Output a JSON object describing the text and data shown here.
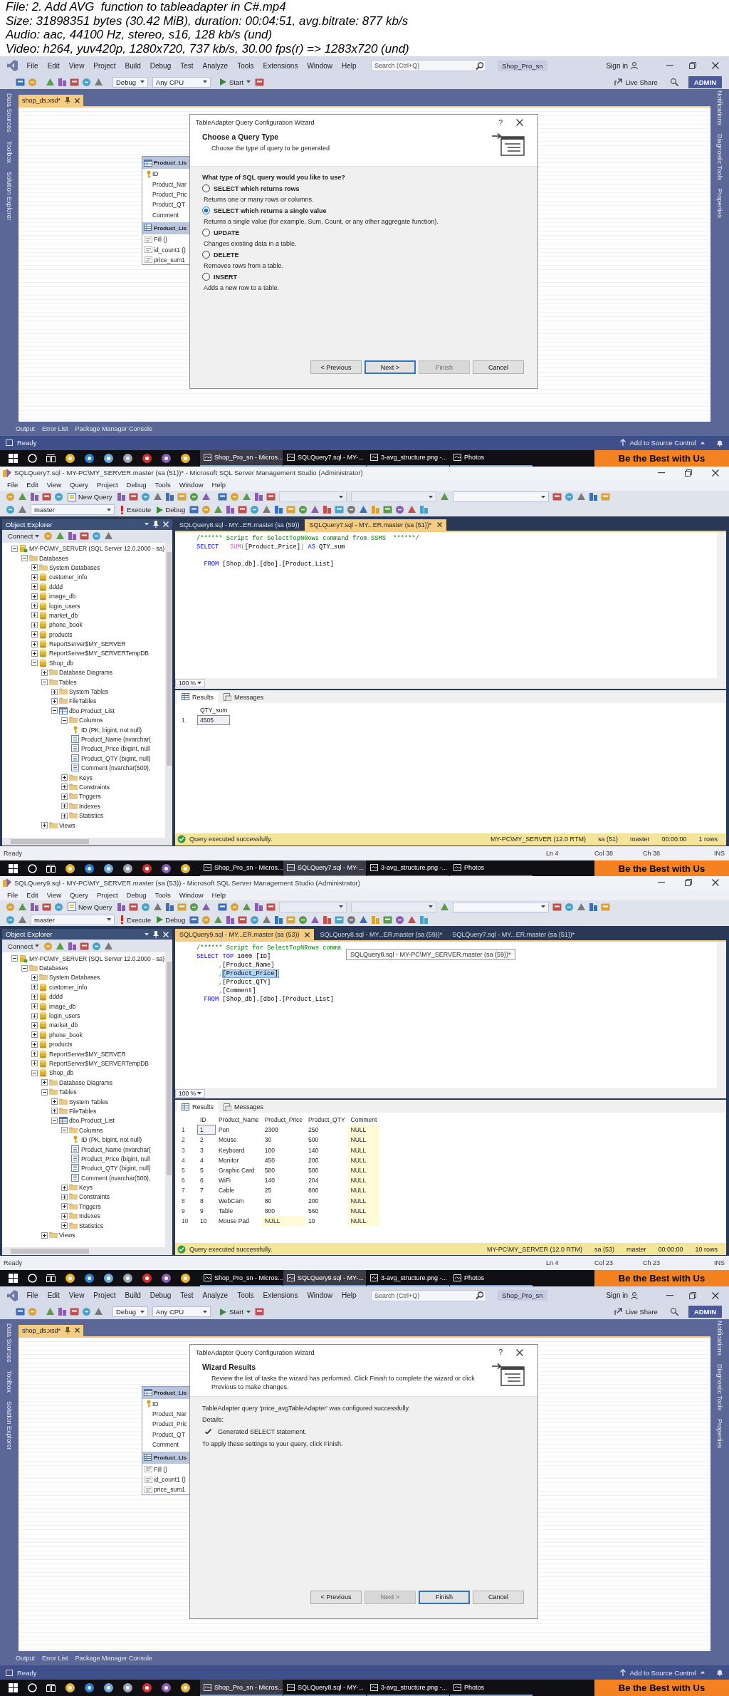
{
  "header": {
    "lines": [
      "File: 2. Add AVG  function to tableadapter in C#.mp4",
      "Size: 31898351 bytes (30.42 MiB), duration: 00:04:51, avg.bitrate: 877 kb/s",
      "Audio: aac, 44100 Hz, stereo, s16, 128 kb/s (und)",
      "Video: h264, yuv420p, 1280x720, 737 kb/s, 30.00 fps(r) => 1283x720 (und)"
    ]
  },
  "frames": [
    {
      "kind": "vs",
      "menu": [
        "File",
        "Edit",
        "View",
        "Project",
        "Build",
        "Debug",
        "Test",
        "Analyze",
        "Tools",
        "Extensions",
        "Window",
        "Help"
      ],
      "search": {
        "placeholder": "Search (Ctrl+Q)"
      },
      "solution_name": "Shop_Pro_sn",
      "sign_in": "Sign in",
      "toolbar": {
        "configuration": "Debug",
        "platform": "Any CPU",
        "start": "Start"
      },
      "live_share": "Live Share",
      "account": "ADMIN",
      "left_rail": [
        "Data Sources",
        "Toolbox",
        "Solution Explorer"
      ],
      "right_rail": [
        "Notifications",
        "Diagnostic Tools",
        "Properties"
      ],
      "document_tab": "shop_ds.xsd*",
      "designer": {
        "table": {
          "title": "Product_Lis",
          "columns": [
            {
              "name": "ID",
              "primary_key": true
            },
            {
              "name": "Product_Nar",
              "primary_key": false
            },
            {
              "name": "Product_Pric",
              "primary_key": false
            },
            {
              "name": "Product_QT",
              "primary_key": false
            },
            {
              "name": "Comment",
              "primary_key": false
            }
          ]
        },
        "adapter": {
          "title": "Product_Lis",
          "methods": [
            "Fill ()",
            "id_count1 ()",
            "price_sum1"
          ]
        }
      },
      "dialog": {
        "kind": "query_type",
        "title": "TableAdapter Query Configuration Wizard",
        "help": "?",
        "heading": "Choose a Query Type",
        "subheading": "Choose the type of query to be generated",
        "question": "What type of SQL query would you like to use?",
        "options": [
          {
            "label": "SELECT which returns rows",
            "description": "Returns one or many rows or columns.",
            "selected": false
          },
          {
            "label": "SELECT which returns a single value",
            "description": "Returns a single value (for example, Sum, Count, or any other aggregate function).",
            "selected": true
          },
          {
            "label": "UPDATE",
            "description": "Changes existing data in a table.",
            "selected": false
          },
          {
            "label": "DELETE",
            "description": "Removes rows from a table.",
            "selected": false
          },
          {
            "label": "INSERT",
            "description": "Adds a new row to a table.",
            "selected": false
          }
        ],
        "buttons": [
          {
            "label": "< Previous",
            "disabled": false,
            "default": false
          },
          {
            "label": "Next >",
            "disabled": false,
            "default": true
          },
          {
            "label": "Finish",
            "disabled": true,
            "default": false
          },
          {
            "label": "Cancel",
            "disabled": false,
            "default": false
          }
        ]
      },
      "bottom_tabs": [
        "Output",
        "Error List",
        "Package Manager Console"
      ],
      "status": {
        "text": "Ready",
        "source_control": "Add to Source Control"
      },
      "taskbar": {
        "items": [
          {
            "label": "Shop_Pro_sn - Micros...",
            "selected": true
          },
          {
            "label": "SQLQuery7.sql - MY-...",
            "selected": false
          },
          {
            "label": "3-avg_structure.png -...",
            "selected": false
          },
          {
            "label": "Photos",
            "selected": false
          }
        ],
        "banner": "Be the Best with Us"
      }
    },
    {
      "kind": "ssms",
      "title": "SQLQuery7.sql - MY-PC\\MY_SERVER.master (sa (51))* - Microsoft SQL Server Management Studio (Administrator)",
      "menu": [
        "File",
        "Edit",
        "View",
        "Query",
        "Project",
        "Debug",
        "Tools",
        "Window",
        "Help"
      ],
      "toolbar": {
        "new_query": "New Query",
        "database": "master",
        "execute": "Execute",
        "debug": "Debug"
      },
      "object_explorer": {
        "title": "Object Explorer",
        "connect": "Connect",
        "tree": [
          {
            "label": "MY-PC\\MY_SERVER (SQL Server 12.0.2000 - sa)",
            "kind": "server",
            "expanded": true,
            "children": [
              {
                "label": "Databases",
                "kind": "folder",
                "expanded": true,
                "children": [
                  {
                    "label": "System Databases",
                    "kind": "folder",
                    "expanded": false
                  },
                  {
                    "label": "customer_info",
                    "kind": "database",
                    "expanded": false
                  },
                  {
                    "label": "dddd",
                    "kind": "database",
                    "expanded": false
                  },
                  {
                    "label": "image_db",
                    "kind": "database",
                    "expanded": false
                  },
                  {
                    "label": "login_users",
                    "kind": "database",
                    "expanded": false
                  },
                  {
                    "label": "market_db",
                    "kind": "database",
                    "expanded": false
                  },
                  {
                    "label": "phone_book",
                    "kind": "database",
                    "expanded": false
                  },
                  {
                    "label": "products",
                    "kind": "database",
                    "expanded": false
                  },
                  {
                    "label": "ReportServer$MY_SERVER",
                    "kind": "database",
                    "expanded": false
                  },
                  {
                    "label": "ReportServer$MY_SERVERTempDB",
                    "kind": "database",
                    "expanded": false
                  },
                  {
                    "label": "Shop_db",
                    "kind": "database",
                    "expanded": true,
                    "children": [
                      {
                        "label": "Database Diagrams",
                        "kind": "folder",
                        "expanded": false
                      },
                      {
                        "label": "Tables",
                        "kind": "folder",
                        "expanded": true,
                        "children": [
                          {
                            "label": "System Tables",
                            "kind": "folder",
                            "expanded": false
                          },
                          {
                            "label": "FileTables",
                            "kind": "folder",
                            "expanded": false
                          },
                          {
                            "label": "dbo.Product_List",
                            "kind": "table",
                            "expanded": true,
                            "children": [
                              {
                                "label": "Columns",
                                "kind": "folder",
                                "expanded": true,
                                "children": [
                                  {
                                    "label": "ID (PK, bigint, not null)",
                                    "kind": "key"
                                  },
                                  {
                                    "label": "Product_Name (nvarchar(",
                                    "kind": "column"
                                  },
                                  {
                                    "label": "Product_Price (bigint, null",
                                    "kind": "column"
                                  },
                                  {
                                    "label": "Product_QTY (bigint, null)",
                                    "kind": "column"
                                  },
                                  {
                                    "label": "Comment (nvarchar(500),",
                                    "kind": "column"
                                  }
                                ]
                              },
                              {
                                "label": "Keys",
                                "kind": "folder",
                                "expanded": false
                              },
                              {
                                "label": "Constraints",
                                "kind": "folder",
                                "expanded": false
                              },
                              {
                                "label": "Triggers",
                                "kind": "folder",
                                "expanded": false
                              },
                              {
                                "label": "Indexes",
                                "kind": "folder",
                                "expanded": false
                              },
                              {
                                "label": "Statistics",
                                "kind": "folder",
                                "expanded": false
                              }
                            ]
                          }
                        ]
                      },
                      {
                        "label": "Views",
                        "kind": "folder",
                        "expanded": false
                      }
                    ]
                  }
                ]
              }
            ]
          }
        ]
      },
      "tabs": [
        {
          "label": "SQLQuery8.sql - MY...ER.master (sa (59))",
          "selected": false
        },
        {
          "label": "SQLQuery7.sql - MY...ER.master (sa (51))*",
          "selected": true
        }
      ],
      "code": [
        {
          "blank_before": false,
          "segments": [
            {
              "text": "/****** Script for SelectTopNRows command from SSMS  ******/",
              "kind": "comment",
              "selected": false
            }
          ]
        },
        {
          "blank_before": false,
          "segments": [
            {
              "text": "SELECT",
              "kind": "keyword",
              "selected": false
            },
            {
              "text": "   SUM",
              "kind": "function",
              "selected": false
            },
            {
              "text": "(",
              "kind": "punctuation",
              "selected": false
            },
            {
              "text": "[Product_Price]",
              "kind": "plain",
              "selected": false
            },
            {
              "text": ") ",
              "kind": "punctuation",
              "selected": false
            },
            {
              "text": "AS",
              "kind": "keyword",
              "selected": false
            },
            {
              "text": " QTY_sum",
              "kind": "plain",
              "selected": false
            }
          ]
        },
        {
          "blank_before": true,
          "segments": [
            {
              "text": "  FROM",
              "kind": "keyword",
              "selected": false
            },
            {
              "text": " [Shop_db].[dbo].[Product_List]",
              "kind": "plain",
              "selected": false
            }
          ]
        }
      ],
      "zoom": "100 %",
      "result_tabs": [
        {
          "label": "Results",
          "selected": true
        },
        {
          "label": "Messages",
          "selected": false
        }
      ],
      "grid": {
        "columns": [
          "QTY_sum"
        ],
        "rows": [
          {
            "number": "1",
            "cells": [
              {
                "text": "4505",
                "null": false,
                "selected": true
              }
            ]
          }
        ]
      },
      "query_status": {
        "message": "Query executed successfully.",
        "server": "MY-PC\\MY_SERVER (12.0 RTM)",
        "login": "sa (51)",
        "database": "master",
        "elapsed": "00:00:00",
        "rows": "1 rows"
      },
      "status": {
        "text": "Ready",
        "line": "Ln 4",
        "column": "Col 38",
        "character": "Ch 38",
        "mode": "INS"
      },
      "taskbar": {
        "items": [
          {
            "label": "Shop_Pro_sn - Micros...",
            "selected": false
          },
          {
            "label": "SQLQuery7.sql - MY-...",
            "selected": true
          },
          {
            "label": "3-avg_structure.png -...",
            "selected": false
          },
          {
            "label": "Photos",
            "selected": false
          }
        ],
        "banner": "Be the Best with Us"
      }
    },
    {
      "kind": "ssms",
      "title": "SQLQuery9.sql - MY-PC\\MY_SERVER.master (sa (53)) - Microsoft SQL Server Management Studio (Administrator)",
      "menu": [
        "File",
        "Edit",
        "View",
        "Query",
        "Project",
        "Debug",
        "Tools",
        "Window",
        "Help"
      ],
      "toolbar": {
        "new_query": "New Query",
        "database": "master",
        "execute": "Execute",
        "debug": "Debug"
      },
      "object_explorer": {
        "title": "Object Explorer",
        "connect": "Connect",
        "tree": [
          {
            "label": "MY-PC\\MY_SERVER (SQL Server 12.0.2000 - sa)",
            "kind": "server",
            "expanded": true,
            "children": [
              {
                "label": "Databases",
                "kind": "folder",
                "expanded": true,
                "children": [
                  {
                    "label": "System Databases",
                    "kind": "folder",
                    "expanded": false
                  },
                  {
                    "label": "customer_info",
                    "kind": "database",
                    "expanded": false
                  },
                  {
                    "label": "dddd",
                    "kind": "database",
                    "expanded": false
                  },
                  {
                    "label": "image_db",
                    "kind": "database",
                    "expanded": false
                  },
                  {
                    "label": "login_users",
                    "kind": "database",
                    "expanded": false
                  },
                  {
                    "label": "market_db",
                    "kind": "database",
                    "expanded": false
                  },
                  {
                    "label": "phone_book",
                    "kind": "database",
                    "expanded": false
                  },
                  {
                    "label": "products",
                    "kind": "database",
                    "expanded": false
                  },
                  {
                    "label": "ReportServer$MY_SERVER",
                    "kind": "database",
                    "expanded": false
                  },
                  {
                    "label": "ReportServer$MY_SERVERTempDB",
                    "kind": "database",
                    "expanded": false
                  },
                  {
                    "label": "Shop_db",
                    "kind": "database",
                    "expanded": true,
                    "children": [
                      {
                        "label": "Database Diagrams",
                        "kind": "folder",
                        "expanded": false
                      },
                      {
                        "label": "Tables",
                        "kind": "folder",
                        "expanded": true,
                        "children": [
                          {
                            "label": "System Tables",
                            "kind": "folder",
                            "expanded": false
                          },
                          {
                            "label": "FileTables",
                            "kind": "folder",
                            "expanded": false
                          },
                          {
                            "label": "dbo.Product_List",
                            "kind": "table",
                            "expanded": true,
                            "children": [
                              {
                                "label": "Columns",
                                "kind": "folder",
                                "expanded": true,
                                "children": [
                                  {
                                    "label": "ID (PK, bigint, not null)",
                                    "kind": "key"
                                  },
                                  {
                                    "label": "Product_Name (nvarchar(",
                                    "kind": "column"
                                  },
                                  {
                                    "label": "Product_Price (bigint, null",
                                    "kind": "column"
                                  },
                                  {
                                    "label": "Product_QTY (bigint, null)",
                                    "kind": "column"
                                  },
                                  {
                                    "label": "Comment (nvarchar(500),",
                                    "kind": "column"
                                  }
                                ]
                              },
                              {
                                "label": "Keys",
                                "kind": "folder",
                                "expanded": false
                              },
                              {
                                "label": "Constraints",
                                "kind": "folder",
                                "expanded": false
                              },
                              {
                                "label": "Triggers",
                                "kind": "folder",
                                "expanded": false
                              },
                              {
                                "label": "Indexes",
                                "kind": "folder",
                                "expanded": false
                              },
                              {
                                "label": "Statistics",
                                "kind": "folder",
                                "expanded": false
                              }
                            ]
                          }
                        ]
                      },
                      {
                        "label": "Views",
                        "kind": "folder",
                        "expanded": false
                      }
                    ]
                  }
                ]
              }
            ]
          }
        ]
      },
      "tabs": [
        {
          "label": "SQLQuery9.sql - MY...ER.master (sa (53))",
          "selected": true
        },
        {
          "label": "SQLQuery8.sql - MY...ER.master (sa (59))*",
          "selected": false
        },
        {
          "label": "SQLQuery7.sql - MY...ER.master (sa (51))*",
          "selected": false
        }
      ],
      "tooltip": "SQLQuery8.sql - MY-PC\\MY_SERVER.master (sa (59))*",
      "code": [
        {
          "blank_before": false,
          "segments": [
            {
              "text": "/****** Script for SelectTopNRows comma",
              "kind": "comment",
              "selected": false
            }
          ]
        },
        {
          "blank_before": false,
          "segments": [
            {
              "text": "SELECT TOP",
              "kind": "keyword",
              "selected": false
            },
            {
              "text": " 1000 [ID]",
              "kind": "plain",
              "selected": false
            }
          ]
        },
        {
          "blank_before": false,
          "segments": [
            {
              "text": "      ,",
              "kind": "punctuation",
              "selected": false
            },
            {
              "text": "[Product_Name]",
              "kind": "plain",
              "selected": false
            }
          ]
        },
        {
          "blank_before": false,
          "segments": [
            {
              "text": "      ,",
              "kind": "punctuation",
              "selected": false
            },
            {
              "text": "[Product_Price]",
              "kind": "plain",
              "selected": true
            }
          ]
        },
        {
          "blank_before": false,
          "segments": [
            {
              "text": "      ,",
              "kind": "punctuation",
              "selected": false
            },
            {
              "text": "[Product_QTY]",
              "kind": "plain",
              "selected": false
            }
          ]
        },
        {
          "blank_before": false,
          "segments": [
            {
              "text": "      ,",
              "kind": "punctuation",
              "selected": false
            },
            {
              "text": "[Comment]",
              "kind": "plain",
              "selected": false
            }
          ]
        },
        {
          "blank_before": false,
          "segments": [
            {
              "text": "  FROM",
              "kind": "keyword",
              "selected": false
            },
            {
              "text": " [Shop_db].[dbo].[Product_List]",
              "kind": "plain",
              "selected": false
            }
          ]
        }
      ],
      "zoom": "100 %",
      "result_tabs": [
        {
          "label": "Results",
          "selected": true
        },
        {
          "label": "Messages",
          "selected": false
        }
      ],
      "grid": {
        "columns": [
          "ID",
          "Product_Name",
          "Product_Price",
          "Product_QTY",
          "Comment"
        ],
        "rows": [
          {
            "number": "1",
            "cells": [
              {
                "text": "1",
                "null": false,
                "selected": true
              },
              {
                "text": "Pen",
                "null": false,
                "selected": false
              },
              {
                "text": "2300",
                "null": false,
                "selected": false
              },
              {
                "text": "250",
                "null": false,
                "selected": false
              },
              {
                "text": "NULL",
                "null": true,
                "selected": false
              }
            ]
          },
          {
            "number": "2",
            "cells": [
              {
                "text": "2",
                "null": false,
                "selected": false
              },
              {
                "text": "Mouse",
                "null": false,
                "selected": false
              },
              {
                "text": "30",
                "null": false,
                "selected": false
              },
              {
                "text": "500",
                "null": false,
                "selected": false
              },
              {
                "text": "NULL",
                "null": true,
                "selected": false
              }
            ]
          },
          {
            "number": "3",
            "cells": [
              {
                "text": "3",
                "null": false,
                "selected": false
              },
              {
                "text": "Keyboard",
                "null": false,
                "selected": false
              },
              {
                "text": "100",
                "null": false,
                "selected": false
              },
              {
                "text": "140",
                "null": false,
                "selected": false
              },
              {
                "text": "NULL",
                "null": true,
                "selected": false
              }
            ]
          },
          {
            "number": "4",
            "cells": [
              {
                "text": "4",
                "null": false,
                "selected": false
              },
              {
                "text": "Monitor",
                "null": false,
                "selected": false
              },
              {
                "text": "450",
                "null": false,
                "selected": false
              },
              {
                "text": "200",
                "null": false,
                "selected": false
              },
              {
                "text": "NULL",
                "null": true,
                "selected": false
              }
            ]
          },
          {
            "number": "5",
            "cells": [
              {
                "text": "5",
                "null": false,
                "selected": false
              },
              {
                "text": "Graphic Card",
                "null": false,
                "selected": false
              },
              {
                "text": "580",
                "null": false,
                "selected": false
              },
              {
                "text": "500",
                "null": false,
                "selected": false
              },
              {
                "text": "NULL",
                "null": true,
                "selected": false
              }
            ]
          },
          {
            "number": "6",
            "cells": [
              {
                "text": "6",
                "null": false,
                "selected": false
              },
              {
                "text": "WiFi",
                "null": false,
                "selected": false
              },
              {
                "text": "140",
                "null": false,
                "selected": false
              },
              {
                "text": "204",
                "null": false,
                "selected": false
              },
              {
                "text": "NULL",
                "null": true,
                "selected": false
              }
            ]
          },
          {
            "number": "7",
            "cells": [
              {
                "text": "7",
                "null": false,
                "selected": false
              },
              {
                "text": "Cable",
                "null": false,
                "selected": false
              },
              {
                "text": "25",
                "null": false,
                "selected": false
              },
              {
                "text": "800",
                "null": false,
                "selected": false
              },
              {
                "text": "NULL",
                "null": true,
                "selected": false
              }
            ]
          },
          {
            "number": "8",
            "cells": [
              {
                "text": "8",
                "null": false,
                "selected": false
              },
              {
                "text": "WebCam",
                "null": false,
                "selected": false
              },
              {
                "text": "80",
                "null": false,
                "selected": false
              },
              {
                "text": "200",
                "null": false,
                "selected": false
              },
              {
                "text": "NULL",
                "null": true,
                "selected": false
              }
            ]
          },
          {
            "number": "9",
            "cells": [
              {
                "text": "9",
                "null": false,
                "selected": false
              },
              {
                "text": "Table",
                "null": false,
                "selected": false
              },
              {
                "text": "800",
                "null": false,
                "selected": false
              },
              {
                "text": "560",
                "null": false,
                "selected": false
              },
              {
                "text": "NULL",
                "null": true,
                "selected": false
              }
            ]
          },
          {
            "number": "10",
            "cells": [
              {
                "text": "10",
                "null": false,
                "selected": false
              },
              {
                "text": "Mouse Pad",
                "null": false,
                "selected": false
              },
              {
                "text": "NULL",
                "null": true,
                "selected": false
              },
              {
                "text": "10",
                "null": false,
                "selected": false
              },
              {
                "text": "NULL",
                "null": true,
                "selected": false
              }
            ]
          }
        ]
      },
      "query_status": {
        "message": "Query executed successfully.",
        "server": "MY-PC\\MY_SERVER (12.0 RTM)",
        "login": "sa (53)",
        "database": "master",
        "elapsed": "00:00:00",
        "rows": "10 rows"
      },
      "status": {
        "text": "Ready",
        "line": "Ln 4",
        "column": "Col 23",
        "character": "Ch 23",
        "mode": "INS"
      },
      "taskbar": {
        "items": [
          {
            "label": "Shop_Pro_sn - Micros...",
            "selected": false
          },
          {
            "label": "SQLQuery9.sql - MY-...",
            "selected": true
          },
          {
            "label": "3-avg_structure.png -...",
            "selected": false
          },
          {
            "label": "Photos",
            "selected": false
          }
        ],
        "banner": "Be the Best with Us"
      }
    },
    {
      "kind": "vs",
      "menu": [
        "File",
        "Edit",
        "View",
        "Project",
        "Build",
        "Debug",
        "Test",
        "Analyze",
        "Tools",
        "Extensions",
        "Window",
        "Help"
      ],
      "search": {
        "placeholder": "Search (Ctrl+Q)"
      },
      "solution_name": "Shop_Pro_sn",
      "sign_in": "Sign in",
      "toolbar": {
        "configuration": "Debug",
        "platform": "Any CPU",
        "start": "Start"
      },
      "live_share": "Live Share",
      "account": "ADMIN",
      "left_rail": [
        "Data Sources",
        "Toolbox",
        "Solution Explorer"
      ],
      "right_rail": [
        "Notifications",
        "Diagnostic Tools",
        "Properties"
      ],
      "document_tab": "shop_ds.xsd*",
      "designer": {
        "table": {
          "title": "Product_Lis",
          "columns": [
            {
              "name": "ID",
              "primary_key": true
            },
            {
              "name": "Product_Nar",
              "primary_key": false
            },
            {
              "name": "Product_Pric",
              "primary_key": false
            },
            {
              "name": "Product_QT",
              "primary_key": false
            },
            {
              "name": "Comment",
              "primary_key": false
            }
          ]
        },
        "adapter": {
          "title": "Product_Lis",
          "methods": [
            "Fill ()",
            "id_count1 ()",
            "price_sum1"
          ]
        }
      },
      "dialog": {
        "kind": "results",
        "title": "TableAdapter Query Configuration Wizard",
        "help": "?",
        "heading": "Wizard Results",
        "subheading": "Review the list of tasks the wizard has performed. Click Finish to complete the wizard or click Previous to make changes.",
        "message": "TableAdapter query 'price_avgTableAdapter' was configured successfully.",
        "details_label": "Details:",
        "tasks": [
          {
            "label": "Generated SELECT statement.",
            "checked": true
          }
        ],
        "footer": "To apply these settings to your query, click Finish.",
        "buttons": [
          {
            "label": "< Previous",
            "disabled": false,
            "default": false
          },
          {
            "label": "Next >",
            "disabled": true,
            "default": false
          },
          {
            "label": "Finish",
            "disabled": false,
            "default": true
          },
          {
            "label": "Cancel",
            "disabled": false,
            "default": false
          }
        ]
      },
      "bottom_tabs": [
        "Output",
        "Error List",
        "Package Manager Console"
      ],
      "status": {
        "text": "Ready",
        "source_control": "Add to Source Control"
      },
      "taskbar": {
        "items": [
          {
            "label": "Shop_Pro_sn - Micros...",
            "selected": true
          },
          {
            "label": "SQLQuery8.sql - MY-...",
            "selected": false
          },
          {
            "label": "3-avg_structure.png -...",
            "selected": false
          },
          {
            "label": "Photos",
            "selected": false
          }
        ],
        "banner": "Be the Best with Us"
      }
    }
  ]
}
